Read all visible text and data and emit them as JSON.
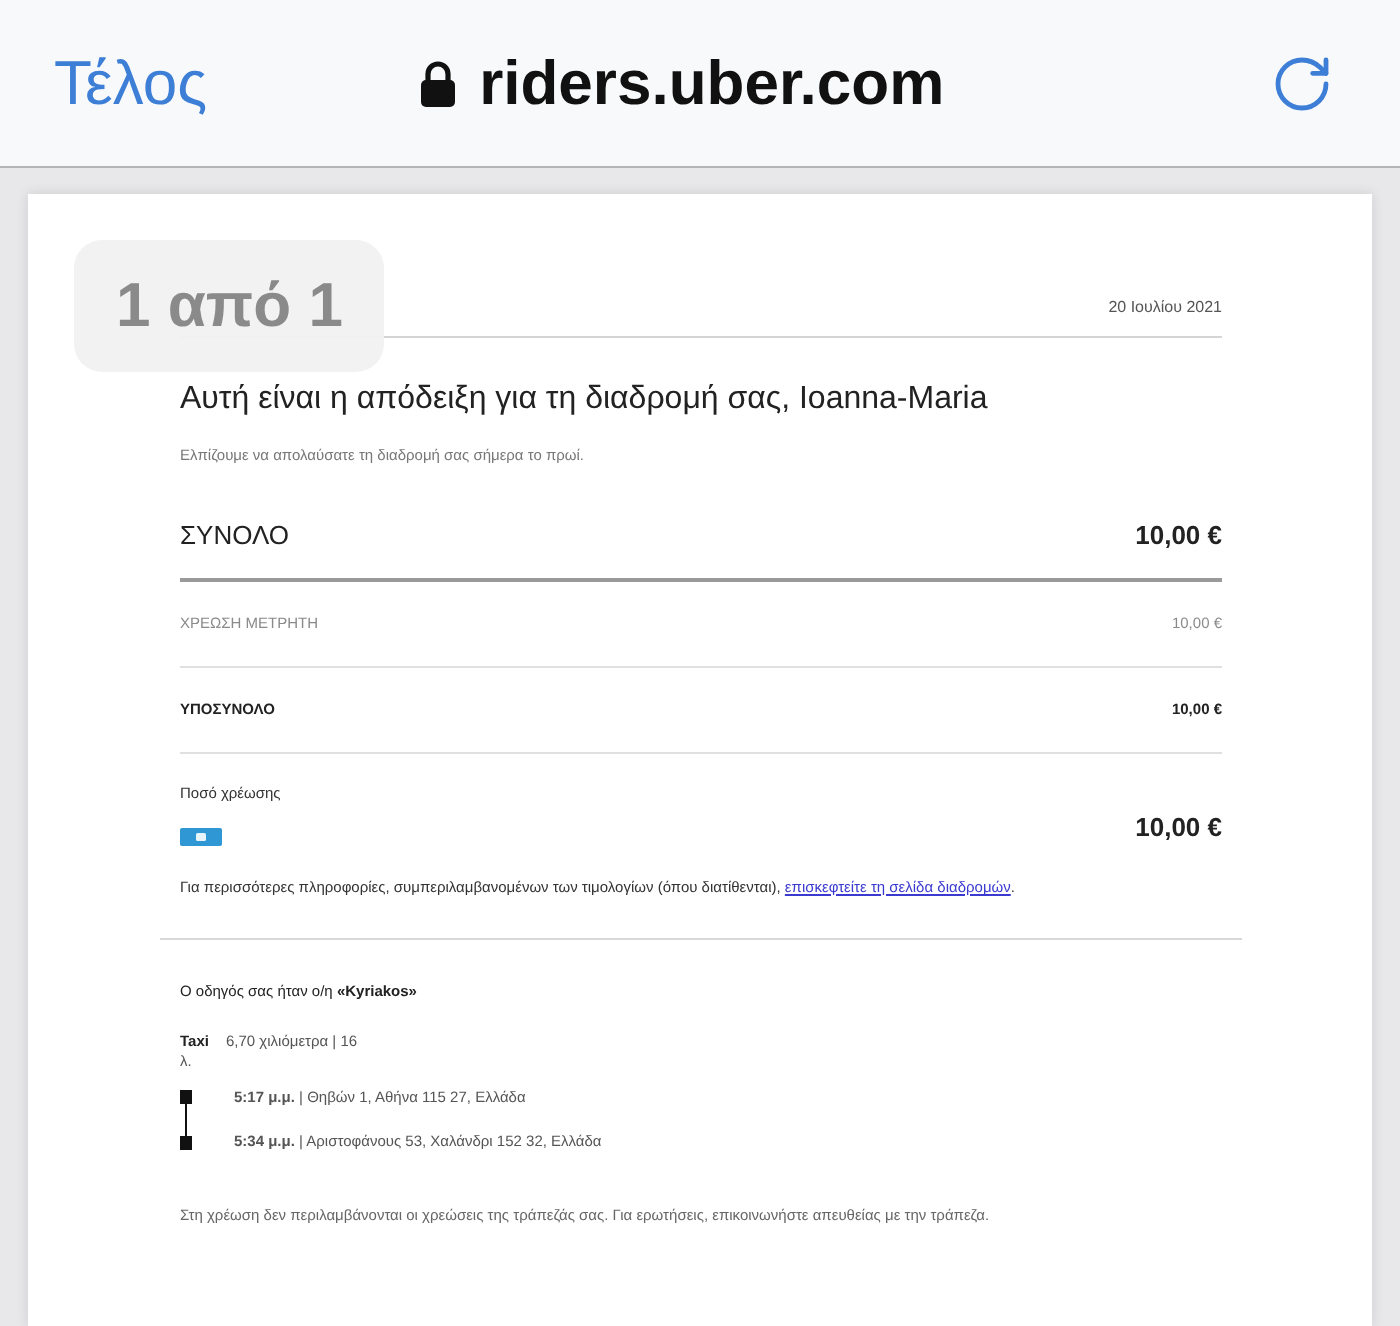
{
  "browser": {
    "done_button": "Τέλος",
    "address": "riders.uber.com"
  },
  "page_indicator": "1 από 1",
  "receipt": {
    "date": "20 Ιουλίου 2021",
    "title": "Αυτή είναι η απόδειξη για τη διαδρομή σας, Ioanna-Maria",
    "subtitle": "Ελπίζουμε να απολαύσατε τη διαδρομή σας σήμερα το πρωί.",
    "total": {
      "label": "ΣΥΝΟΛΟ",
      "amount": "10,00 €"
    },
    "lines": [
      {
        "kind": "muted",
        "label": "ΧΡΕΩΣΗ ΜΕΤΡΗΤΗ",
        "amount": "10,00 €"
      },
      {
        "kind": "bold",
        "label": "ΥΠΟΣΥΝΟΛΟ",
        "amount": "10,00 €"
      }
    ],
    "payment": {
      "label": "Ποσό χρέωσης",
      "amount": "10,00 €"
    },
    "info": {
      "text": "Για περισσότερες πληροφορίες, συμπεριλαμβανομένων των τιμολογίων (όπου διατίθενται),",
      "link": "επισκεφτείτε τη σελίδα διαδρομών",
      "after": "."
    },
    "driver": "Ο οδηγός σας ήταν ο/η **«Kyriakos»**",
    "trip": {
      "vehicle": "Taxi",
      "stats": "6,70 χιλιόμετρα | 16",
      "stats_wrap": "λ.",
      "stops": [
        {
          "text": "**5:17 μ.μ.** | Θηβών 1, Αθήνα 115 27, Ελλάδα"
        },
        {
          "text": "**5:34 μ.μ.** | Αριστοφάνους 53, Χαλάνδρι 152 32, Ελλάδα"
        }
      ]
    },
    "footer": "Στη χρέωση δεν περιλαμβάνονται οι χρεώσεις της τράπεζάς σας. Για ερωτήσεις, επικοινωνήστε απευθείας με την τράπεζα."
  }
}
